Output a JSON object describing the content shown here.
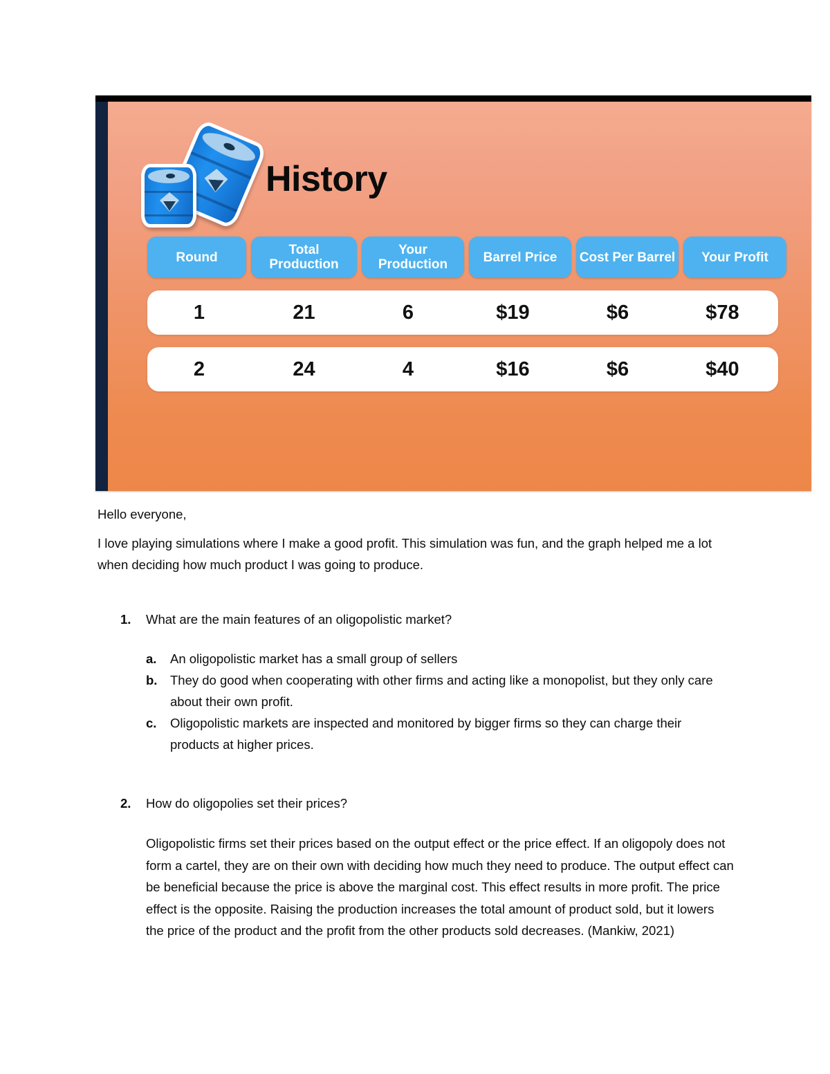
{
  "figure": {
    "title": "History",
    "icon": "oil-barrels-icon",
    "colors": {
      "gradient_top": "#f4ab8f",
      "gradient_bottom": "#ed8749",
      "header_pill": "#4db2ef",
      "border": "#12233f",
      "top_strip": "#000000",
      "row_background": "#ffffff"
    },
    "table": {
      "columns": [
        "Round",
        "Total Production",
        "Your Production",
        "Barrel Price",
        "Cost Per Barrel",
        "Your Profit"
      ],
      "rows": [
        {
          "round": "1",
          "total_production": "21",
          "your_production": "6",
          "barrel_price": "$19",
          "cost_per_barrel": "$6",
          "your_profit": "$78"
        },
        {
          "round": "2",
          "total_production": "24",
          "your_production": "4",
          "barrel_price": "$16",
          "cost_per_barrel": "$6",
          "your_profit": "$40"
        }
      ]
    }
  },
  "document": {
    "greeting": "Hello everyone,",
    "intro": "I love playing simulations where I make a good profit. This simulation was fun, and the graph helped me a lot when deciding how much product I was going to produce.",
    "questions": [
      {
        "number": "1.",
        "text": "What are the main features of an oligopolistic market?",
        "sub_items": [
          {
            "marker": "a.",
            "text": "An oligopolistic market has a small group of sellers"
          },
          {
            "marker": "b.",
            "text": "They do good when cooperating with other firms and acting like a monopolist, but they only care about their own profit."
          },
          {
            "marker": "c.",
            "text": "Oligopolistic markets are inspected and monitored by bigger firms so they can charge their products at higher prices."
          }
        ]
      },
      {
        "number": "2.",
        "text": "How do oligopolies set their prices?",
        "answer": "Oligopolistic firms set their prices based on the output effect or the price effect. If an oligopoly does not form a cartel, they are on their own with deciding how much they need to produce. The output effect can be beneficial because the price is above the marginal cost.  This effect results in more profit. The price effect is the opposite. Raising the production increases the total amount of product sold, but it lowers the price of the product and the profit from the other products sold decreases. (Mankiw, 2021)"
      }
    ]
  }
}
